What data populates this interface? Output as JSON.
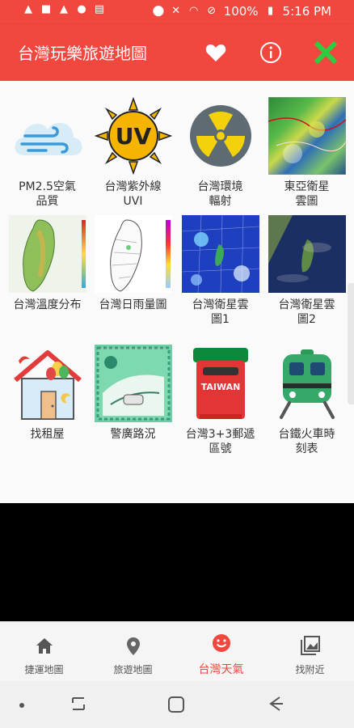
{
  "status_bar": {
    "battery": "100%",
    "time": "5:16 PM"
  },
  "app_bar": {
    "title": "台灣玩樂旅遊地圖"
  },
  "grid_items": [
    {
      "label": "PM2.5空氣\n品質"
    },
    {
      "label": "台灣紫外線\nUVI"
    },
    {
      "label": "台灣環境\n輻射"
    },
    {
      "label": "東亞衛星\n雲圖"
    },
    {
      "label": "台灣溫度分布"
    },
    {
      "label": "台灣日雨量圖"
    },
    {
      "label": "台灣衛星雲\n圖1"
    },
    {
      "label": "台灣衛星雲\n圖2"
    },
    {
      "label": "找租屋"
    },
    {
      "label": "警廣路況"
    },
    {
      "label": "台灣3+3郵遞\n區號"
    },
    {
      "label": "台鐵火車時\n刻表"
    }
  ],
  "uv_text": "UV",
  "post_text": "TAIWAN",
  "bottom_nav": [
    {
      "label": "捷運地圖"
    },
    {
      "label": "旅遊地圖"
    },
    {
      "label": "台灣天氣"
    },
    {
      "label": "找附近"
    }
  ],
  "colors": {
    "accent": "#f2473f",
    "active_tab": "#f2473f"
  }
}
